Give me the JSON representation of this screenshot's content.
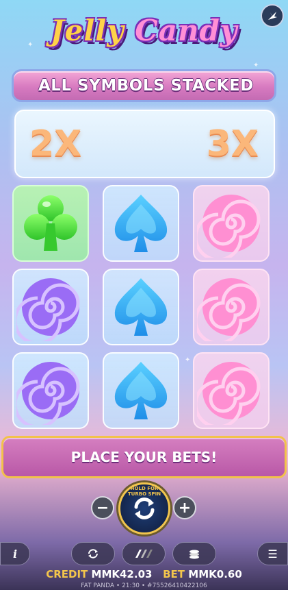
{
  "game": {
    "logo_word1": "Jelly",
    "logo_word2": "Candy",
    "feature_banner": "ALL SYMBOLS STACKED",
    "multipliers": [
      "2X",
      "3X"
    ],
    "status_message": "PLACE YOUR BETS!",
    "spin_hint": "HOLD FOR TURBO SPIN",
    "grid": [
      [
        "green-club",
        "blue-spade",
        "pink-swirl"
      ],
      [
        "purple-swirl",
        "blue-spade",
        "pink-swirl"
      ],
      [
        "purple-swirl",
        "blue-spade",
        "pink-swirl"
      ]
    ]
  },
  "controls": {
    "decrease_label": "−",
    "increase_label": "+",
    "info_label": "i",
    "menu_label": "☰",
    "icons": [
      "info-icon",
      "autoplay-icon",
      "turbo-icon",
      "bet-coins-icon",
      "menu-icon",
      "sound-icon"
    ]
  },
  "balance": {
    "credit_label": "CREDIT",
    "credit_value": "MMK42.03",
    "bet_label": "BET",
    "bet_value": "MMK0.60"
  },
  "footer": {
    "text": "FAT PANDA • 21:30 • #75526410422106"
  },
  "colors": {
    "banner": "#d77ac0",
    "bets_border": "#f2c24a",
    "accent_gold": "#f4c64b",
    "multiplier": "#fbb77a"
  }
}
